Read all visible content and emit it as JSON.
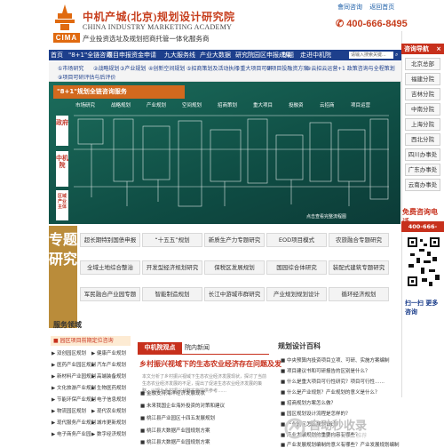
{
  "header": {
    "brand_cn": "中机产城(北京)规划设计研究院",
    "brand_en": "CHINA INDUSTRY MARKETING ACADEMY",
    "logo_text": "CIMA",
    "slogan": "产业投资选址及规划招商托管一体化服务商",
    "top_links": [
      "會同咨询",
      "返回首页"
    ],
    "hotline": "400-666-8495"
  },
  "nav": {
    "items": [
      "首页",
      "\"8+1\"全链咨询",
      "项目申报资金申请",
      "九大服务线",
      "产业大数据",
      "研究院园区申报成果",
      "专题",
      "走进中机院"
    ],
    "search_placeholder": "请输入搜索关键..."
  },
  "subnav": {
    "row1": [
      "①市场研究",
      "②战略规划",
      "③产业规划",
      "④创新空间规划",
      "⑤招商策划及活动执行",
      "⑥重大项目可研",
      "⑦项目投融资方案",
      "⑧云招云运营",
      "+1 政策咨询与全程策划"
    ],
    "row2": [
      "⑨项目可研评估与后评价"
    ]
  },
  "banner": {
    "title": "\"8+1\"规划全链咨询服务",
    "bands": [
      "政府",
      "中机院",
      "区域产业主体"
    ],
    "steps": [
      "市场研究",
      "战略规划",
      "产业规划",
      "空间规划",
      "招商策划",
      "重大项目",
      "投融资",
      "云招商",
      "项目运营"
    ],
    "caption": "点击查看完整流程图"
  },
  "consult": {
    "title": "咨询导航",
    "close": "×",
    "branches": [
      "北京总部",
      "福建分院",
      "吉林分院",
      "中南分院",
      "上海分院",
      "西北分院",
      "四川办事处",
      "广东办事处",
      "云南办事处"
    ],
    "free_label": "免费咨询电话",
    "phone": "400-666-8495",
    "scan": "扫一扫 更多咨询"
  },
  "topics": {
    "side_label": "专题研究",
    "items": [
      [
        "超长期特别国债申报",
        "“十五五”规划",
        "新质生产力专题研究",
        "EOD项目模式",
        "农旅融合专题研究"
      ],
      [
        "全域土地综合整治",
        "开发型经济规划研究",
        "保税区发展规划",
        "国园综合体研究",
        "装配式建筑专题研究"
      ],
      [
        "军民融合产业园专题",
        "智能制造规划",
        "长江中游城市群研究",
        "产业规划规划设计",
        "循环经济规划"
      ]
    ]
  },
  "service": {
    "title": "服务领域",
    "highlight": "■ 园区项目前期定位咨询",
    "items": [
      [
        "▶ 双创园区规划",
        "▶ 健康产业规划"
      ],
      [
        "▶ 医药产业园区规划",
        "▶ 汽车产业规划"
      ],
      [
        "▶ 新材料产业园规划",
        "▶ 高端装备规划"
      ],
      [
        "▶ 文化旅游产业规划",
        "▶ 生物医药规划"
      ],
      [
        "▶ 节能环保产业规划",
        "▶ 电子信息规划"
      ],
      [
        "▶ 物流园区规划",
        "▶ 现代农业规划"
      ],
      [
        "▶ 现代服务产业规划",
        "▶ 城市更新规划"
      ],
      [
        "▶ 电子商务产业园",
        "▶ 数字经济规划"
      ]
    ]
  },
  "news": {
    "tab_active": "中机院观点",
    "tab_inactive": "院内新闻",
    "headline": "乡村振兴视域下的生态农业经济存在问题及发",
    "summary": "本文分析了乡村振兴视域下生态农业经济发展现状，探讨了当前生态农业经济发展的不足，提出了促进生态农业经济发展的策略，以期为乡村振兴战略实施提供参考……",
    "items": [
      "■ 金融支持海洋经济发展现状",
      "■ 未来我国企业海外投资的对策和建议",
      "■ 桃江县产业园区十四五发展规划",
      "■ 桃江县大数据产业园规划方案",
      "■ 桃江县大数据产业园规划方案"
    ]
  },
  "planning": {
    "title": "规划设计百科",
    "items": [
      "■ 中央预算内投资项目立项、可研、实施方案编制",
      "■ 项目建议书和可研报告的区别是什么？",
      "■ 什么是重大项目可行性研究？项目可行性……",
      "■ 什么是产业规划？产业规划的意义是什么？",
      "■ 招商规划方案怎么做？",
      "■ 园区规划设计流程是怎样的？",
      "■ 产业园区怎么规划设计？",
      "■ 产业发展规划的重要内容有哪些？",
      "■ 产业发展规划编制的意义有哪些？产业发展规划编制"
    ]
  },
  "watermark": {
    "text": "自动秒收录",
    "sub": "收录 · 秒收 · 优质 · 推荐"
  },
  "colors": {
    "brand_red": "#c7301c",
    "nav_blue": "#1d3f8c",
    "banner_green": "#1c6d5c",
    "topic_gold": "#ba8c3a"
  }
}
